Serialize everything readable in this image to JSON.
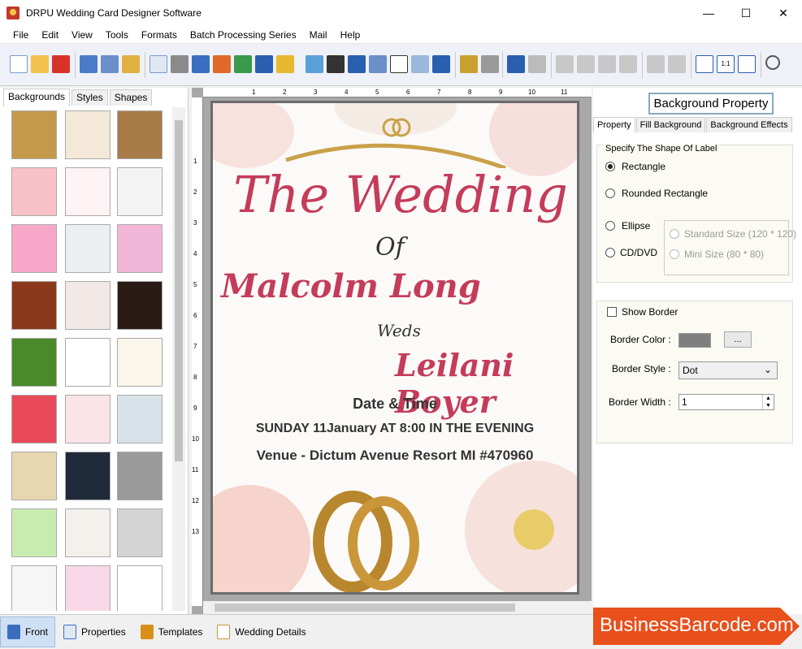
{
  "window": {
    "title": "DRPU Wedding Card Designer Software"
  },
  "menu": [
    "File",
    "Edit",
    "View",
    "Tools",
    "Formats",
    "Batch Processing Series",
    "Mail",
    "Help"
  ],
  "left_panel": {
    "tabs": [
      "Backgrounds",
      "Styles",
      "Shapes"
    ],
    "active_tab": "Backgrounds"
  },
  "ruler": {
    "h_ticks": [
      "1",
      "2",
      "3",
      "4",
      "5",
      "6",
      "7",
      "8",
      "9",
      "10",
      "11"
    ],
    "v_ticks": [
      "1",
      "2",
      "3",
      "4",
      "5",
      "6",
      "7",
      "8",
      "9",
      "10",
      "11",
      "12",
      "13"
    ]
  },
  "card": {
    "title": "The Wedding",
    "of": "Of",
    "groom": "Malcolm Long",
    "weds": "Weds",
    "bride": "Leilani Boyer",
    "date_heading": "Date & Time",
    "date_text": "SUNDAY 11January AT 8:00 IN THE EVENING",
    "venue_label": "Venue",
    "venue_dash": "-",
    "venue_text": "Dictum Avenue Resort MI #470960"
  },
  "right_panel": {
    "header": "Background Property",
    "tabs": [
      "Property",
      "Fill Background",
      "Background Effects"
    ],
    "shape_group_title": "Specify The Shape Of Label",
    "shapes": {
      "rectangle": "Rectangle",
      "rounded_rectangle": "Rounded Rectangle",
      "ellipse": "Ellipse",
      "cd_dvd": "CD/DVD",
      "standard_size": "Standard Size (120 * 120)",
      "mini_size": "Mini Size (80 * 80)",
      "selected": "Rectangle"
    },
    "border": {
      "show_label": "Show Border",
      "show_checked": false,
      "color_label": "Border Color :",
      "color_value": "#7f7f7f",
      "browse_label": "...",
      "style_label": "Border Style :",
      "style_value": "Dot",
      "width_label": "Border Width :",
      "width_value": "1"
    }
  },
  "bottom_tabs": [
    "Front",
    "Properties",
    "Templates",
    "Wedding Details"
  ],
  "active_bottom_tab": "Front",
  "brand": "BusinessBarcode.com",
  "colors": {
    "accent_orange": "#e8501c",
    "script_pink": "#c43c5a"
  }
}
